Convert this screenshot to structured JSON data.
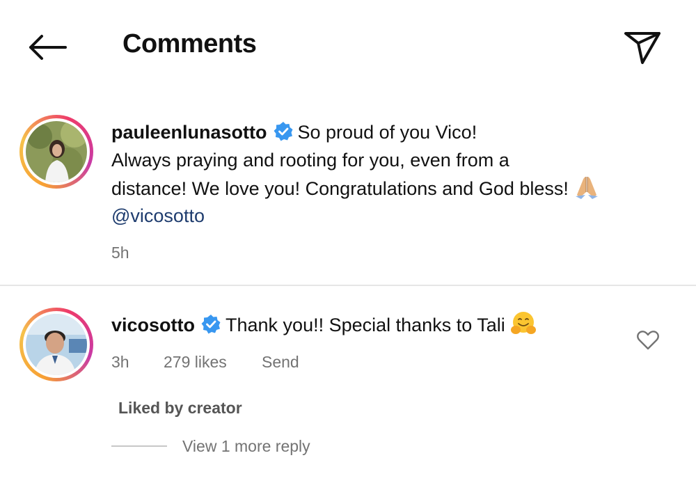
{
  "header": {
    "title": "Comments"
  },
  "comments": [
    {
      "username": "pauleenlunasotto",
      "text_line1": "So proud of you Vico!",
      "text_line2": "Always praying and rooting for you, even from a",
      "text_line3": "distance! We love you! Congratulations and God bless!",
      "emoji": "praying-hands-icon",
      "mention": "@vicosotto",
      "time": "5h"
    },
    {
      "username": "vicosotto",
      "text": "Thank you!! Special thanks to Tali",
      "emoji": "hugging-face-icon",
      "time": "3h",
      "likes": "279 likes",
      "send_label": "Send",
      "liked_by_creator": "Liked by creator",
      "view_replies": "View 1 more reply"
    }
  ],
  "colors": {
    "text": "#111111",
    "meta": "#737373",
    "mention": "#1e3c6e",
    "verified": "#3897f0",
    "divider": "#e6e6e6"
  }
}
